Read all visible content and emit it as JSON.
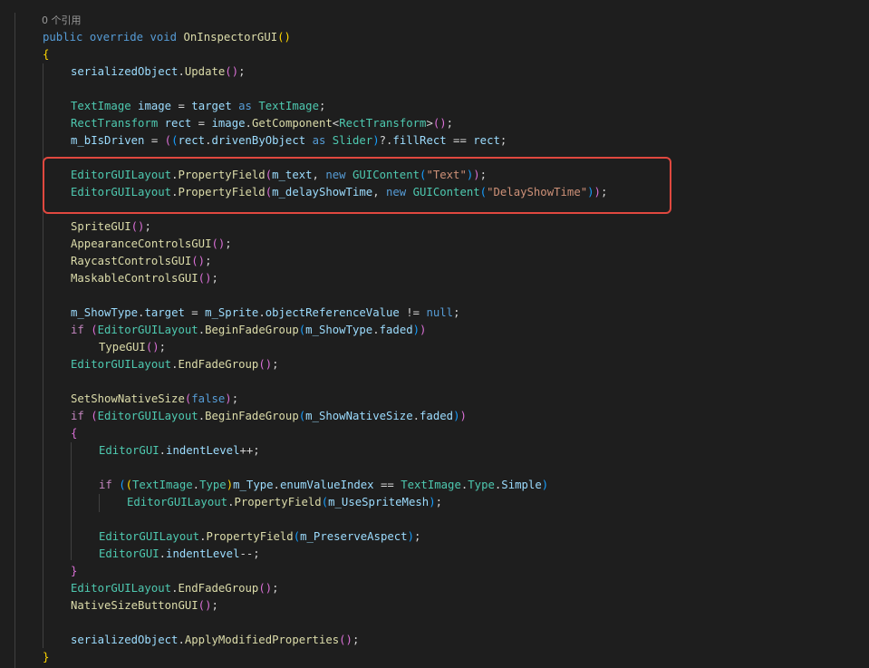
{
  "editor": {
    "codelens": "0 个引用",
    "highlight_color": "#e0483f",
    "lines": [
      [
        [
          "kw",
          "public"
        ],
        [
          "p",
          " "
        ],
        [
          "kw",
          "override"
        ],
        [
          "p",
          " "
        ],
        [
          "kw",
          "void"
        ],
        [
          "p",
          " "
        ],
        [
          "fn",
          "OnInspectorGUI"
        ],
        [
          "b1",
          "()"
        ]
      ],
      [
        [
          "b1",
          "{"
        ]
      ],
      [
        [
          "var",
          "serializedObject"
        ],
        [
          "p",
          "."
        ],
        [
          "fn",
          "Update"
        ],
        [
          "b2",
          "()"
        ],
        [
          "p",
          ";"
        ]
      ],
      [],
      [
        [
          "ty",
          "TextImage"
        ],
        [
          "p",
          " "
        ],
        [
          "var",
          "image"
        ],
        [
          "p",
          " = "
        ],
        [
          "var",
          "target"
        ],
        [
          "p",
          " "
        ],
        [
          "kw",
          "as"
        ],
        [
          "p",
          " "
        ],
        [
          "ty",
          "TextImage"
        ],
        [
          "p",
          ";"
        ]
      ],
      [
        [
          "ty",
          "RectTransform"
        ],
        [
          "p",
          " "
        ],
        [
          "var",
          "rect"
        ],
        [
          "p",
          " = "
        ],
        [
          "var",
          "image"
        ],
        [
          "p",
          "."
        ],
        [
          "fn",
          "GetComponent"
        ],
        [
          "p",
          "<"
        ],
        [
          "ty",
          "RectTransform"
        ],
        [
          "p",
          ">"
        ],
        [
          "b2",
          "()"
        ],
        [
          "p",
          ";"
        ]
      ],
      [
        [
          "var",
          "m_bIsDriven"
        ],
        [
          "p",
          " = "
        ],
        [
          "b2",
          "("
        ],
        [
          "b3",
          "("
        ],
        [
          "var",
          "rect"
        ],
        [
          "p",
          "."
        ],
        [
          "var",
          "drivenByObject"
        ],
        [
          "p",
          " "
        ],
        [
          "kw",
          "as"
        ],
        [
          "p",
          " "
        ],
        [
          "ty",
          "Slider"
        ],
        [
          "b3",
          ")"
        ],
        [
          "p",
          "?."
        ],
        [
          "var",
          "fillRect"
        ],
        [
          "p",
          " == "
        ],
        [
          "var",
          "rect"
        ],
        [
          "p",
          ";"
        ]
      ],
      [],
      [
        [
          "ty",
          "EditorGUILayout"
        ],
        [
          "p",
          "."
        ],
        [
          "fn",
          "PropertyField"
        ],
        [
          "b2",
          "("
        ],
        [
          "var",
          "m_text"
        ],
        [
          "p",
          ", "
        ],
        [
          "kw",
          "new"
        ],
        [
          "p",
          " "
        ],
        [
          "ty",
          "GUIContent"
        ],
        [
          "b3",
          "("
        ],
        [
          "str",
          "\"Text\""
        ],
        [
          "b3",
          ")"
        ],
        [
          "b2",
          ")"
        ],
        [
          "p",
          ";"
        ]
      ],
      [
        [
          "ty",
          "EditorGUILayout"
        ],
        [
          "p",
          "."
        ],
        [
          "fn",
          "PropertyField"
        ],
        [
          "b2",
          "("
        ],
        [
          "var",
          "m_delayShowTime"
        ],
        [
          "p",
          ", "
        ],
        [
          "kw",
          "new"
        ],
        [
          "p",
          " "
        ],
        [
          "ty",
          "GUIContent"
        ],
        [
          "b3",
          "("
        ],
        [
          "str",
          "\"DelayShowTime\""
        ],
        [
          "b3",
          ")"
        ],
        [
          "b2",
          ")"
        ],
        [
          "p",
          ";"
        ]
      ],
      [],
      [
        [
          "fn",
          "SpriteGUI"
        ],
        [
          "b2",
          "()"
        ],
        [
          "p",
          ";"
        ]
      ],
      [
        [
          "fn",
          "AppearanceControlsGUI"
        ],
        [
          "b2",
          "()"
        ],
        [
          "p",
          ";"
        ]
      ],
      [
        [
          "fn",
          "RaycastControlsGUI"
        ],
        [
          "b2",
          "()"
        ],
        [
          "p",
          ";"
        ]
      ],
      [
        [
          "fn",
          "MaskableControlsGUI"
        ],
        [
          "b2",
          "()"
        ],
        [
          "p",
          ";"
        ]
      ],
      [],
      [
        [
          "var",
          "m_ShowType"
        ],
        [
          "p",
          "."
        ],
        [
          "var",
          "target"
        ],
        [
          "p",
          " = "
        ],
        [
          "var",
          "m_Sprite"
        ],
        [
          "p",
          "."
        ],
        [
          "var",
          "objectReferenceValue"
        ],
        [
          "p",
          " != "
        ],
        [
          "kw",
          "null"
        ],
        [
          "p",
          ";"
        ]
      ],
      [
        [
          "ctl",
          "if"
        ],
        [
          "p",
          " "
        ],
        [
          "b2",
          "("
        ],
        [
          "ty",
          "EditorGUILayout"
        ],
        [
          "p",
          "."
        ],
        [
          "fn",
          "BeginFadeGroup"
        ],
        [
          "b3",
          "("
        ],
        [
          "var",
          "m_ShowType"
        ],
        [
          "p",
          "."
        ],
        [
          "var",
          "faded"
        ],
        [
          "b3",
          ")"
        ],
        [
          "b2",
          ")"
        ]
      ],
      [
        [
          "fn",
          "TypeGUI"
        ],
        [
          "b2",
          "()"
        ],
        [
          "p",
          ";"
        ]
      ],
      [
        [
          "ty",
          "EditorGUILayout"
        ],
        [
          "p",
          "."
        ],
        [
          "fn",
          "EndFadeGroup"
        ],
        [
          "b2",
          "()"
        ],
        [
          "p",
          ";"
        ]
      ],
      [],
      [
        [
          "fn",
          "SetShowNativeSize"
        ],
        [
          "b2",
          "("
        ],
        [
          "kw",
          "false"
        ],
        [
          "b2",
          ")"
        ],
        [
          "p",
          ";"
        ]
      ],
      [
        [
          "ctl",
          "if"
        ],
        [
          "p",
          " "
        ],
        [
          "b2",
          "("
        ],
        [
          "ty",
          "EditorGUILayout"
        ],
        [
          "p",
          "."
        ],
        [
          "fn",
          "BeginFadeGroup"
        ],
        [
          "b3",
          "("
        ],
        [
          "var",
          "m_ShowNativeSize"
        ],
        [
          "p",
          "."
        ],
        [
          "var",
          "faded"
        ],
        [
          "b3",
          ")"
        ],
        [
          "b2",
          ")"
        ]
      ],
      [
        [
          "b2",
          "{"
        ]
      ],
      [
        [
          "ty",
          "EditorGUI"
        ],
        [
          "p",
          "."
        ],
        [
          "var",
          "indentLevel"
        ],
        [
          "p",
          "++;"
        ]
      ],
      [],
      [
        [
          "ctl",
          "if"
        ],
        [
          "p",
          " "
        ],
        [
          "b3",
          "("
        ],
        [
          "b1",
          "("
        ],
        [
          "ty",
          "TextImage"
        ],
        [
          "p",
          "."
        ],
        [
          "ty",
          "Type"
        ],
        [
          "b1",
          ")"
        ],
        [
          "var",
          "m_Type"
        ],
        [
          "p",
          "."
        ],
        [
          "var",
          "enumValueIndex"
        ],
        [
          "p",
          " == "
        ],
        [
          "ty",
          "TextImage"
        ],
        [
          "p",
          "."
        ],
        [
          "ty",
          "Type"
        ],
        [
          "p",
          "."
        ],
        [
          "var",
          "Simple"
        ],
        [
          "b3",
          ")"
        ]
      ],
      [
        [
          "ty",
          "EditorGUILayout"
        ],
        [
          "p",
          "."
        ],
        [
          "fn",
          "PropertyField"
        ],
        [
          "b3",
          "("
        ],
        [
          "var",
          "m_UseSpriteMesh"
        ],
        [
          "b3",
          ")"
        ],
        [
          "p",
          ";"
        ]
      ],
      [],
      [
        [
          "ty",
          "EditorGUILayout"
        ],
        [
          "p",
          "."
        ],
        [
          "fn",
          "PropertyField"
        ],
        [
          "b3",
          "("
        ],
        [
          "var",
          "m_PreserveAspect"
        ],
        [
          "b3",
          ")"
        ],
        [
          "p",
          ";"
        ]
      ],
      [
        [
          "ty",
          "EditorGUI"
        ],
        [
          "p",
          "."
        ],
        [
          "var",
          "indentLevel"
        ],
        [
          "p",
          "--;"
        ]
      ],
      [
        [
          "b2",
          "}"
        ]
      ],
      [
        [
          "ty",
          "EditorGUILayout"
        ],
        [
          "p",
          "."
        ],
        [
          "fn",
          "EndFadeGroup"
        ],
        [
          "b2",
          "()"
        ],
        [
          "p",
          ";"
        ]
      ],
      [
        [
          "fn",
          "NativeSizeButtonGUI"
        ],
        [
          "b2",
          "()"
        ],
        [
          "p",
          ";"
        ]
      ],
      [],
      [
        [
          "var",
          "serializedObject"
        ],
        [
          "p",
          "."
        ],
        [
          "fn",
          "ApplyModifiedProperties"
        ],
        [
          "b2",
          "()"
        ],
        [
          "p",
          ";"
        ]
      ],
      [
        [
          "b1",
          "}"
        ]
      ]
    ]
  }
}
